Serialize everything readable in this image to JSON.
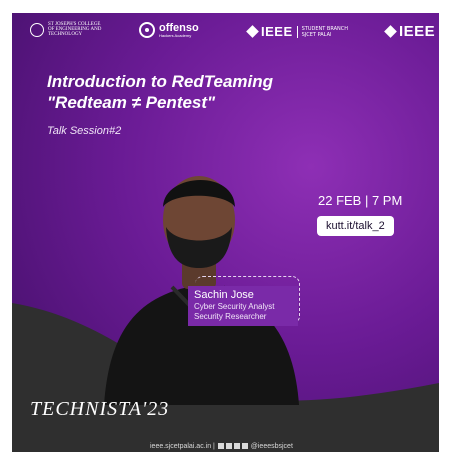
{
  "header": {
    "college_logo_text": "ST JOSEPH'S COLLEGE OF ENGINEERING AND TECHNOLOGY",
    "offenso_name": "offenso",
    "offenso_sub": "Hackers Academy",
    "ieee_sb_name": "IEEE",
    "ieee_sb_sub_line1": "STUDENT BRANCH",
    "ieee_sb_sub_line2": "SJCET PALAI",
    "ieee_name": "IEEE"
  },
  "event": {
    "title_line1": "Introduction to RedTeaming",
    "title_line2": "\"Redteam ≠ Pentest\"",
    "session": "Talk Session#2",
    "date_time": "22 FEB | 7 PM",
    "link": "kutt.it/talk_2"
  },
  "speaker": {
    "name": "Sachin Jose",
    "role1": "Cyber Security Analyst",
    "role2": "Security Researcher"
  },
  "brand": "TECHNISTA'23",
  "footer": {
    "website": "ieee.sjcetpalai.ac.in |",
    "handle": "@ieeesbsjcet"
  },
  "colors": {
    "background_purple": "#6a1b95",
    "dark_band": "#2f2f2f",
    "namebox_purple": "#7a2aa8"
  }
}
